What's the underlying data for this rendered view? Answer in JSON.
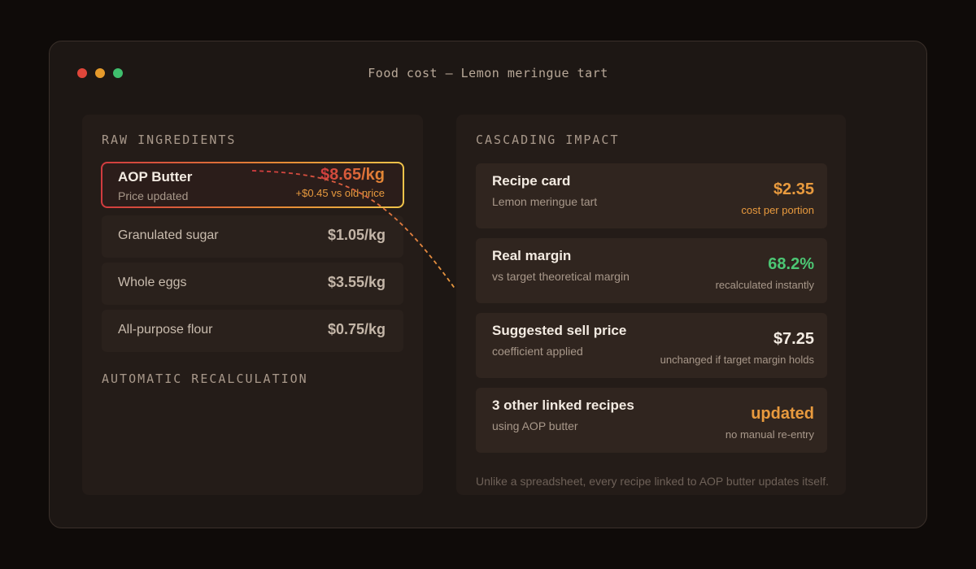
{
  "window": {
    "title": "Food cost — Lemon meringue tart"
  },
  "left_panel": {
    "section_title": "RAW INGREDIENTS",
    "highlighted": {
      "name": "AOP Butter",
      "status": "Price updated",
      "price": "$8.65/kg",
      "delta": "+$0.45 vs old price"
    },
    "ingredients": [
      {
        "name": "Granulated sugar",
        "price": "$1.05/kg"
      },
      {
        "name": "Whole eggs",
        "price": "$3.55/kg"
      },
      {
        "name": "All-purpose flour",
        "price": "$0.75/kg"
      }
    ],
    "recalc_title": "AUTOMATIC RECALCULATION"
  },
  "right_panel": {
    "section_title": "CASCADING IMPACT",
    "cards": [
      {
        "title": "Recipe card",
        "subtitle": "Lemon meringue tart",
        "value": "$2.35",
        "note": "cost per portion",
        "value_color": "#e89a3e",
        "note_color": "#e89a3e"
      },
      {
        "title": "Real margin",
        "subtitle": "vs target theoretical margin",
        "value": "68.2%",
        "note": "recalculated instantly",
        "value_color": "#4cc774",
        "note_color": "#a8988a"
      },
      {
        "title": "Suggested sell price",
        "subtitle": "coefficient applied",
        "value": "$7.25",
        "note": "unchanged if target margin holds",
        "value_color": "#f3ebe2",
        "note_color": "#a8988a"
      },
      {
        "title": "3 other linked recipes",
        "subtitle": "using AOP butter",
        "value": "updated",
        "note": "no manual re-entry",
        "value_color": "#e89a3e",
        "note_color": "#a8988a"
      }
    ],
    "footnote": "Unlike a spreadsheet, every recipe linked to AOP butter updates itself."
  },
  "colors": {
    "accent_red": "#d13b3f",
    "accent_orange": "#e89a3e",
    "accent_yellow": "#f0c44a",
    "positive_green": "#4cc774"
  }
}
